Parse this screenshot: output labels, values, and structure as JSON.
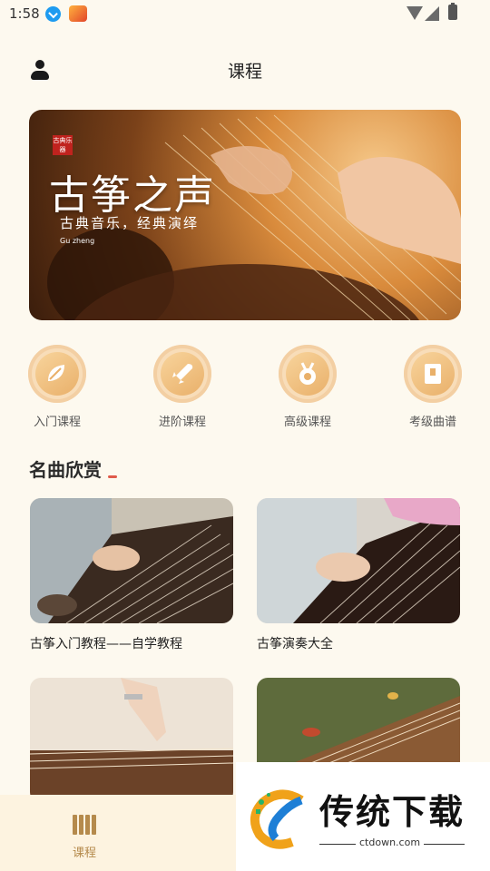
{
  "status_bar": {
    "time": "1:58"
  },
  "header": {
    "title": "课程"
  },
  "banner": {
    "seal_text": "古典乐器",
    "title": "古筝之声",
    "subtitle": "古典音乐，经典演绎",
    "pinyin": "Gu zheng"
  },
  "categories": [
    {
      "label": "入门课程",
      "icon": "leaf-icon"
    },
    {
      "label": "进阶课程",
      "icon": "rocket-icon"
    },
    {
      "label": "高级课程",
      "icon": "medal-icon"
    },
    {
      "label": "考级曲谱",
      "icon": "book-icon"
    }
  ],
  "section": {
    "title": "名曲欣赏"
  },
  "cards": [
    {
      "title": "古筝入门教程——自学教程"
    },
    {
      "title": "古筝演奏大全"
    },
    {
      "title": ""
    },
    {
      "title": ""
    }
  ],
  "bottom_nav": {
    "items": [
      {
        "label": "课程",
        "icon": "books-icon"
      },
      {
        "label": ""
      }
    ]
  },
  "watermark": {
    "title": "传统下载",
    "url": "ctdown.com"
  },
  "colors": {
    "background": "#fdf9ef",
    "accent": "#b58a4c",
    "category_circle": "#f8ddb9"
  }
}
